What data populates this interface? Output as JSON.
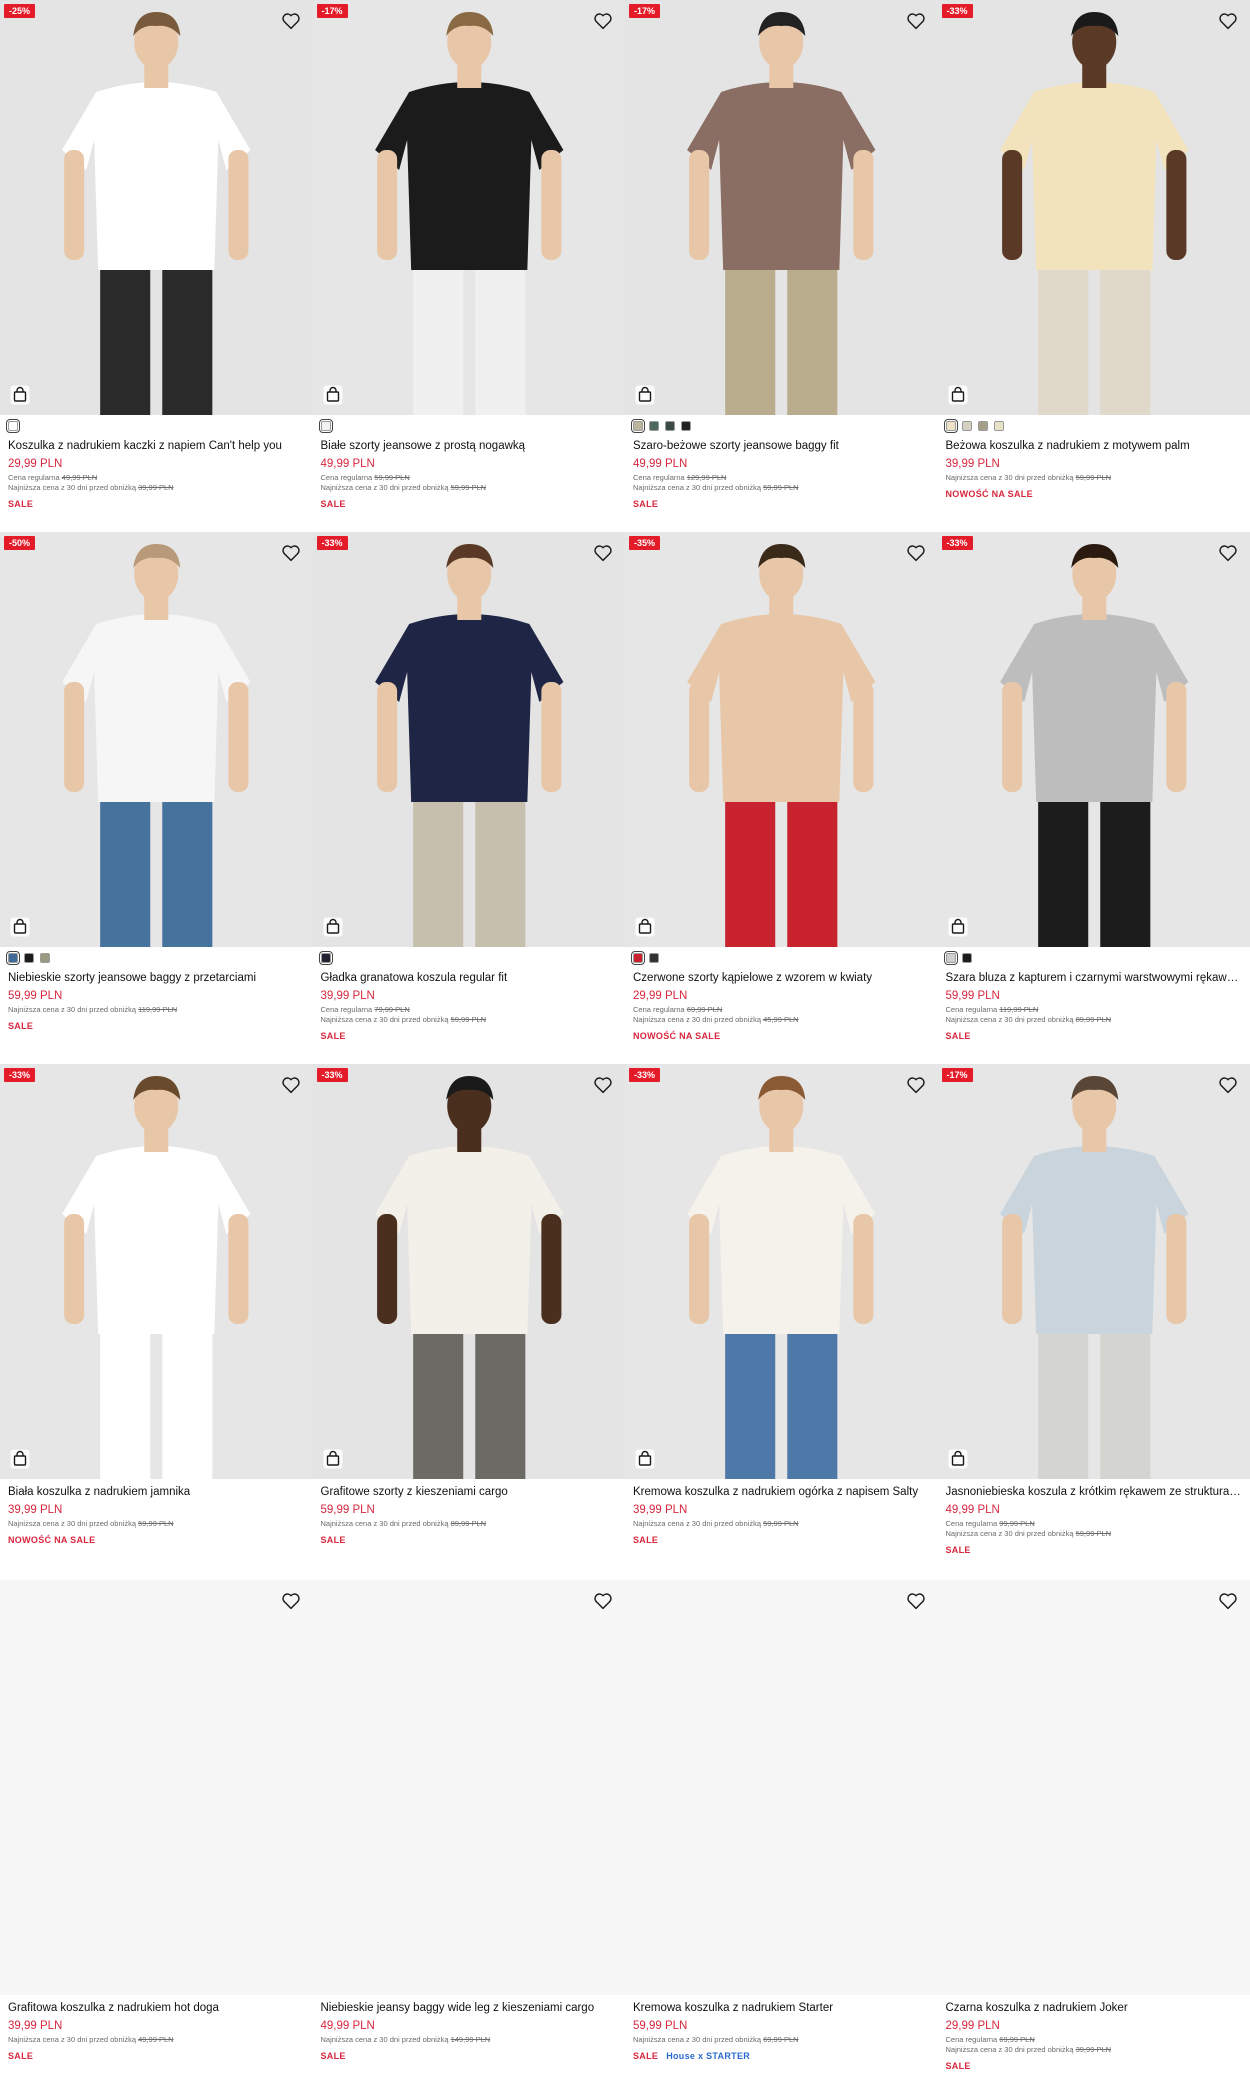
{
  "products": [
    {
      "badge": "-25%",
      "name": "Koszulka z nadrukiem kaczki z napiem Can't help you",
      "price": "29,99 PLN",
      "regular": "Cena regularna",
      "regular_price": "49,99 PLN",
      "lowest": "Najniższa cena z 30 dni przed obniżką",
      "lowest_price": "39,99 PLN",
      "tag": "SALE",
      "swatches": [
        "#ffffff"
      ],
      "photo": {
        "bg": "#e4e4e4",
        "top": "#ffffff",
        "bottom": "#2a2a2a",
        "skin": "#e8c7a8",
        "hair": "#7a5a3c"
      }
    },
    {
      "badge": "-17%",
      "name": "Białe szorty jeansowe z prostą nogawką",
      "price": "49,99 PLN",
      "regular": "Cena regularna",
      "regular_price": "59,99 PLN",
      "lowest": "Najniższa cena z 30 dni przed obniżką",
      "lowest_price": "59,99 PLN",
      "tag": "SALE",
      "swatches": [
        "#f3f3f3"
      ],
      "photo": {
        "bg": "#e6e6e6",
        "top": "#1b1b1b",
        "bottom": "#f0f0f0",
        "skin": "#e8c7a8",
        "hair": "#8a6a45"
      }
    },
    {
      "badge": "-17%",
      "name": "Szaro-beżowe szorty jeansowe baggy fit",
      "price": "49,99 PLN",
      "regular": "Cena regularna",
      "regular_price": "129,99 PLN",
      "lowest": "Najniższa cena z 30 dni przed obniżką",
      "lowest_price": "59,99 PLN",
      "tag": "SALE",
      "swatches": [
        "#bdb59c",
        "#4e6a5c",
        "#3b4a42",
        "#222222"
      ],
      "photo": {
        "bg": "#e4e4e4",
        "top": "#8a6d63",
        "bottom": "#b9ad8d",
        "skin": "#e8c7a8",
        "hair": "#222222"
      }
    },
    {
      "badge": "-33%",
      "name": "Beżowa koszulka z nadrukiem z motywem palm",
      "price": "39,99 PLN",
      "regular": "",
      "regular_price": "",
      "lowest": "Najniższa cena z 30 dni przed obniżką",
      "lowest_price": "59,99 PLN",
      "tag": "NOWOŚĆ NA SALE",
      "swatches": [
        "#efe3c6",
        "#d6d0c2",
        "#a79e8a",
        "#e9e1c8"
      ],
      "photo": {
        "bg": "#e4e4e4",
        "top": "#f3e3bc",
        "bottom": "#e0d8c8",
        "skin": "#5a3a26",
        "hair": "#1a1a1a"
      }
    },
    {
      "badge": "-50%",
      "name": "Niebieskie szorty jeansowe baggy z przetarciami",
      "price": "59,99 PLN",
      "regular": "",
      "regular_price": "",
      "lowest": "Najniższa cena z 30 dni przed obniżką",
      "lowest_price": "119,99 PLN",
      "tag": "SALE",
      "swatches": [
        "#3f6b96",
        "#1c1c1c",
        "#9a9a80"
      ],
      "photo": {
        "bg": "#e6e6e6",
        "top": "#f6f6f6",
        "bottom": "#46739e",
        "skin": "#e8c7a8",
        "hair": "#b89a7a"
      }
    },
    {
      "badge": "-33%",
      "name": "Gładka granatowa koszula regular fit",
      "price": "39,99 PLN",
      "regular": "Cena regularna",
      "regular_price": "79,99 PLN",
      "lowest": "Najniższa cena z 30 dni przed obniżką",
      "lowest_price": "59,99 PLN",
      "tag": "SALE",
      "swatches": [
        "#1f2333"
      ],
      "photo": {
        "bg": "#e4e4e4",
        "top": "#1f2544",
        "bottom": "#c7bfae",
        "skin": "#e8c7a8",
        "hair": "#5a3a26"
      }
    },
    {
      "badge": "-35%",
      "name": "Czerwone szorty kąpielowe z wzorem w kwiaty",
      "price": "29,99 PLN",
      "regular": "Cena regularna",
      "regular_price": "69,99 PLN",
      "lowest": "Najniższa cena z 30 dni przed obniżką",
      "lowest_price": "45,99 PLN",
      "tag": "NOWOŚĆ NA SALE",
      "swatches": [
        "#c8222f",
        "#333333"
      ],
      "photo": {
        "bg": "#e6e6e6",
        "top": "#e8c7a8",
        "bottom": "#c8222f",
        "skin": "#e8c7a8",
        "hair": "#3a2a1a"
      }
    },
    {
      "badge": "-33%",
      "name": "Szara bluza z kapturem i czarnymi warstwowymi rękawami",
      "price": "59,99 PLN",
      "regular": "Cena regularna",
      "regular_price": "119,99 PLN",
      "lowest": "Najniższa cena z 30 dni przed obniżką",
      "lowest_price": "89,99 PLN",
      "tag": "SALE",
      "swatches": [
        "#cfcfcf",
        "#1c1c1c"
      ],
      "photo": {
        "bg": "#e6e6e6",
        "top": "#bdbdbd",
        "bottom": "#1c1c1c",
        "skin": "#e8c7a8",
        "hair": "#2a1a10"
      }
    },
    {
      "badge": "-33%",
      "name": "Biała koszulka z nadrukiem jamnika",
      "price": "39,99 PLN",
      "regular": "",
      "regular_price": "",
      "lowest": "Najniższa cena z 30 dni przed obniżką",
      "lowest_price": "59,99 PLN",
      "tag": "NOWOŚĆ NA SALE",
      "swatches": [],
      "photo": {
        "bg": "#e6e6e6",
        "top": "#ffffff",
        "bottom": "#ffffff",
        "skin": "#e8c7a8",
        "hair": "#6a4a2c"
      }
    },
    {
      "badge": "-33%",
      "name": "Grafitowe szorty z kieszeniami cargo",
      "price": "59,99 PLN",
      "regular": "",
      "regular_price": "",
      "lowest": "Najniższa cena z 30 dni przed obniżką",
      "lowest_price": "89,99 PLN",
      "tag": "SALE",
      "swatches": [],
      "photo": {
        "bg": "#e4e4e4",
        "top": "#f2f0e8",
        "bottom": "#6b6a64",
        "skin": "#4a2e1e",
        "hair": "#1a1a1a"
      }
    },
    {
      "badge": "-33%",
      "name": "Kremowa koszulka z nadrukiem ogórka z napisem Salty",
      "price": "39,99 PLN",
      "regular": "",
      "regular_price": "",
      "lowest": "Najniższa cena z 30 dni przed obniżką",
      "lowest_price": "59,99 PLN",
      "tag": "SALE",
      "swatches": [],
      "photo": {
        "bg": "#e6e6e6",
        "top": "#f4f2ea",
        "bottom": "#4d78a8",
        "skin": "#e8c7a8",
        "hair": "#8a5a34"
      }
    },
    {
      "badge": "-17%",
      "name": "Jasnoniebieska koszula z krótkim rękawem ze strukturalną tkaniną",
      "price": "49,99 PLN",
      "regular": "Cena regularna",
      "regular_price": "99,99 PLN",
      "lowest": "Najniższa cena z 30 dni przed obniżką",
      "lowest_price": "59,99 PLN",
      "tag": "SALE",
      "swatches": [],
      "photo": {
        "bg": "#e6e6e6",
        "top": "#c9d4dc",
        "bottom": "#d4d4d0",
        "skin": "#e8c7a8",
        "hair": "#5a4636"
      }
    },
    {
      "badge": "",
      "name": "Grafitowa koszulka z nadrukiem hot doga",
      "price": "39,99 PLN",
      "regular": "",
      "regular_price": "",
      "lowest": "Najniższa cena z 30 dni przed obniżką",
      "lowest_price": "49,99 PLN",
      "tag": "SALE",
      "swatches": [],
      "photo": null
    },
    {
      "badge": "",
      "name": "Niebieskie jeansy baggy wide leg z kieszeniami cargo",
      "price": "49,99 PLN",
      "regular": "",
      "regular_price": "",
      "lowest": "Najniższa cena z 30 dni przed obniżką",
      "lowest_price": "149,99 PLN",
      "tag": "SALE",
      "swatches": [],
      "photo": null
    },
    {
      "badge": "",
      "name": "Kremowa koszulka z nadrukiem Starter",
      "price": "59,99 PLN",
      "regular": "",
      "regular_price": "",
      "lowest": "Najniższa cena z 30 dni przed obniżką",
      "lowest_price": "69,99 PLN",
      "tag": "SALE",
      "tag_extra": "House x STARTER",
      "swatches": [],
      "photo": null
    },
    {
      "badge": "",
      "name": "Czarna koszulka z nadrukiem Joker",
      "price": "29,99 PLN",
      "regular": "Cena regularna",
      "regular_price": "69,99 PLN",
      "lowest": "Najniższa cena z 30 dni przed obniżką",
      "lowest_price": "39,99 PLN",
      "tag": "SALE",
      "swatches": [],
      "photo": null
    }
  ],
  "icons": {
    "wishlist": "heart-icon",
    "cart": "shopping-bag-icon"
  },
  "colors": {
    "sale_red": "#d7263d",
    "badge_red": "#e41c2a",
    "link_blue": "#2a6ad0"
  }
}
